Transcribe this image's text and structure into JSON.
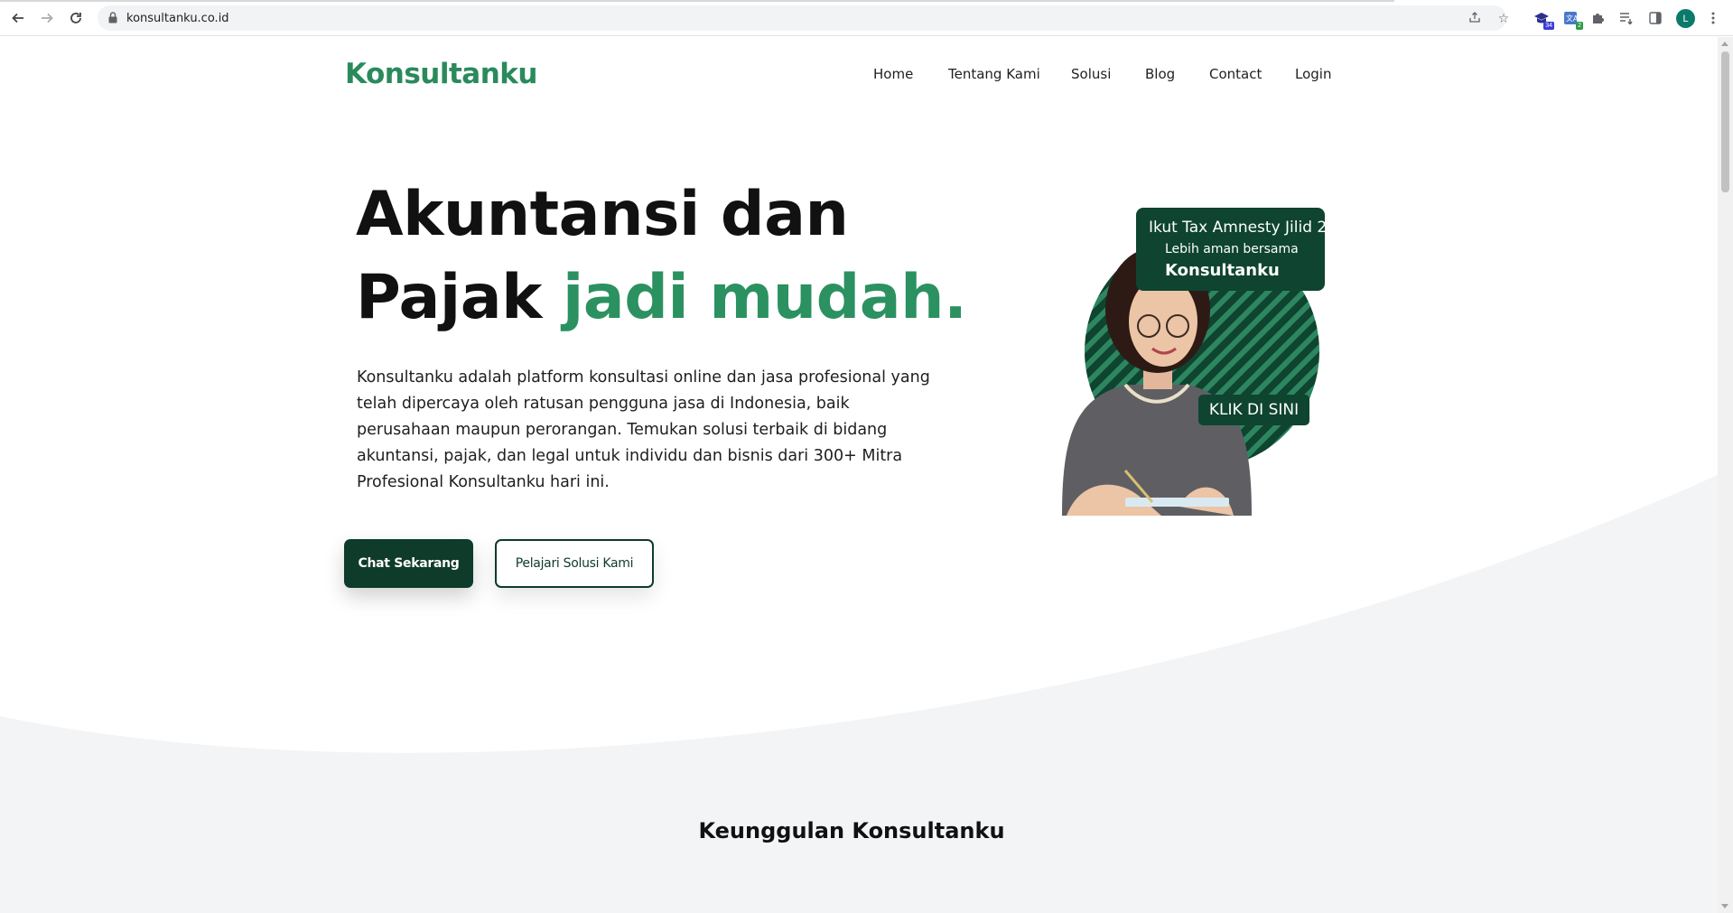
{
  "browser": {
    "url": "konsultanku.co.id",
    "extensions": [
      {
        "name": "graduation-cap-extension",
        "badge": "34",
        "badge_color": "#3b3bd8"
      },
      {
        "name": "translate-extension",
        "badge": "2",
        "badge_color": "#2e9b46"
      }
    ],
    "profile_initial": "L"
  },
  "site": {
    "logo": "Konsultanku",
    "nav": [
      "Home",
      "Tentang Kami",
      "Solusi",
      "Blog",
      "Contact",
      "Login"
    ]
  },
  "hero": {
    "title_line1": "Akuntansi dan",
    "title_line2_plain": "Pajak ",
    "title_line2_accent": "jadi mudah.",
    "description": "Konsultanku adalah platform konsultasi online dan jasa profesional yang telah dipercaya oleh ratusan pengguna jasa di Indonesia, baik perusahaan maupun perorangan. Temukan solusi terbaik di bidang akuntansi, pajak, dan legal untuk individu dan bisnis dari 300+ Mitra Profesional Konsultanku hari ini.",
    "primary_button": "Chat Sekarang",
    "secondary_button": "Pelajari Solusi Kami"
  },
  "promo": {
    "line1": "Ikut Tax Amnesty Jilid 2",
    "line2": "Lebih aman bersama",
    "line3": "Konsultanku",
    "cta": "KLIK DI SINI"
  },
  "section": {
    "title": "Keunggulan Konsultanku"
  },
  "colors": {
    "brand_green": "#2a8a5c",
    "dark_green": "#0e3b2a",
    "section_bg": "#f3f4f5"
  }
}
